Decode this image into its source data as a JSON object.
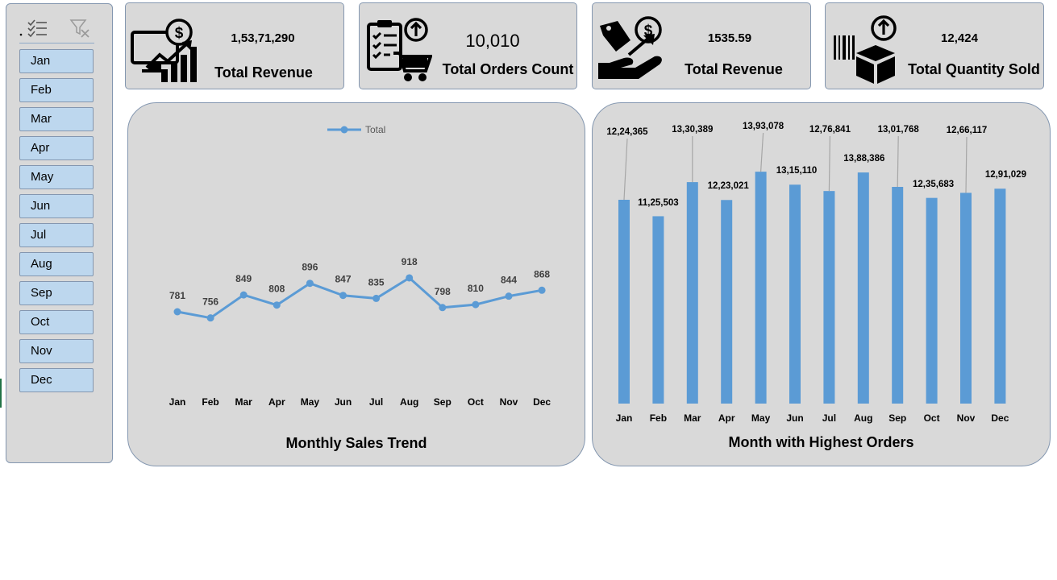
{
  "slicer": {
    "months": [
      "Jan",
      "Feb",
      "Mar",
      "Apr",
      "May",
      "Jun",
      "Jul",
      "Aug",
      "Sep",
      "Oct",
      "Nov",
      "Dec"
    ],
    "multi_select_icon": "multi-select-icon",
    "clear_filter_icon": "clear-filter-icon"
  },
  "kpis": [
    {
      "value": "1,53,71,290",
      "label": "Total Revenue",
      "icon": "monitor-revenue-chart-icon"
    },
    {
      "value": "10,010",
      "label": "Total Orders Count",
      "icon": "clipboard-cart-icon"
    },
    {
      "value": "1535.59",
      "label": "Total Revenue",
      "icon": "hand-price-tag-icon"
    },
    {
      "value": "12,424",
      "label": "Total Quantity Sold",
      "icon": "barcode-box-icon"
    }
  ],
  "colors": {
    "series": "#5b9bd5",
    "panel": "#d9d9d9",
    "slicer_button": "#bdd7ee",
    "border": "#8497b0"
  },
  "line_panel": {
    "title": "Monthly Sales Trend"
  },
  "bar_panel": {
    "title": "Month with Highest Orders"
  },
  "chart_data": [
    {
      "type": "line",
      "title": "Monthly Sales Trend",
      "categories": [
        "Jan",
        "Feb",
        "Mar",
        "Apr",
        "May",
        "Jun",
        "Jul",
        "Aug",
        "Sep",
        "Oct",
        "Nov",
        "Dec"
      ],
      "series": [
        {
          "name": "Total",
          "values": [
            781,
            756,
            849,
            808,
            896,
            847,
            835,
            918,
            798,
            810,
            844,
            868
          ]
        }
      ],
      "data_labels": [
        "781",
        "756",
        "849",
        "808",
        "896",
        "847",
        "835",
        "918",
        "798",
        "810",
        "844",
        "868"
      ],
      "legend": "top",
      "grid": false
    },
    {
      "type": "bar",
      "title": "Month with Highest Orders",
      "categories": [
        "Jan",
        "Feb",
        "Mar",
        "Apr",
        "May",
        "Jun",
        "Jul",
        "Aug",
        "Sep",
        "Oct",
        "Nov",
        "Dec"
      ],
      "values": [
        1224365,
        1125503,
        1330389,
        1223021,
        1393078,
        1315110,
        1276841,
        1388386,
        1301768,
        1235683,
        1266117,
        1291029
      ],
      "data_labels": [
        "12,24,365",
        "11,25,503",
        "13,30,389",
        "12,23,021",
        "13,93,078",
        "13,15,110",
        "12,76,841",
        "13,88,386",
        "13,01,768",
        "12,35,683",
        "12,66,117",
        "12,91,029"
      ],
      "ylim": [
        0,
        1400000
      ],
      "grid": false
    }
  ]
}
